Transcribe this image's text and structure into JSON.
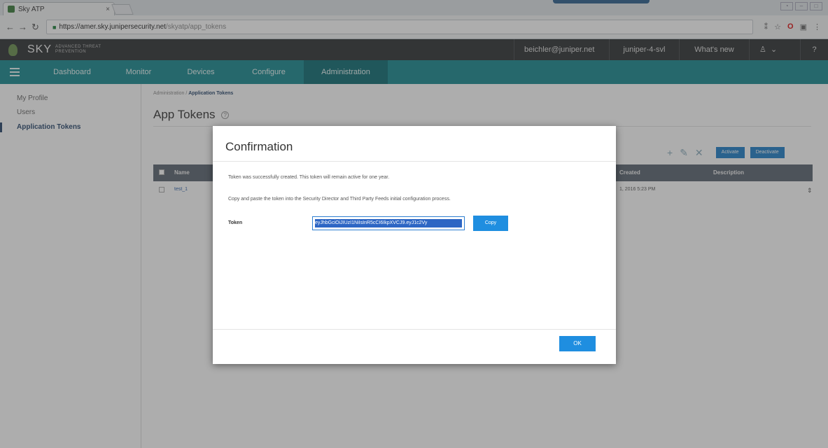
{
  "browser": {
    "tab_title": "Sky ATP",
    "tab_close": "×",
    "url_host": "https://amer.sky.junipersecurity.net",
    "url_path": "/skyatp/app_tokens"
  },
  "header": {
    "brand": "SKY",
    "brand_sub": "ADVANCED THREAT PREVENTION",
    "user": "beichler@juniper.net",
    "realm": "juniper-4-svl",
    "whats_new": "What's new",
    "help": "?"
  },
  "nav": {
    "items": [
      {
        "label": "Dashboard"
      },
      {
        "label": "Monitor"
      },
      {
        "label": "Devices"
      },
      {
        "label": "Configure"
      },
      {
        "label": "Administration"
      }
    ]
  },
  "sidebar": {
    "items": [
      {
        "label": "My Profile"
      },
      {
        "label": "Users"
      },
      {
        "label": "Application Tokens"
      }
    ]
  },
  "page": {
    "breadcrumb_root": "Administration",
    "breadcrumb_sep": "/",
    "breadcrumb_current": "Application Tokens",
    "title": "App Tokens",
    "help": "?",
    "activate": "Activate",
    "deactivate": "Deactivate",
    "columns": {
      "name": "Name",
      "created": "Created",
      "description": "Description"
    },
    "rows": [
      {
        "name": "test_1",
        "created": "1, 2016 5:23 PM"
      }
    ]
  },
  "modal": {
    "title": "Confirmation",
    "message_1": "Token was successfully created. This token will remain active for one year.",
    "message_2": "Copy and paste the token into the Security Director and Third Party Feeds initial configuration process.",
    "token_label": "Token",
    "token_value": "eyJhbGciOiJIUzI1NiIsInR5cCI6IkpXVCJ9.eyJ1c2Vy",
    "copy": "Copy",
    "ok": "OK"
  },
  "colors": {
    "nav_bg": "#17888f",
    "nav_active": "#0d6c73",
    "header_bg": "#2e3133",
    "button_blue": "#1f8ee0"
  }
}
